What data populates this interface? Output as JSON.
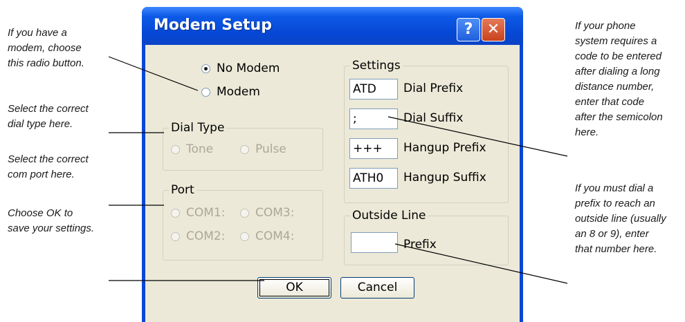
{
  "window": {
    "title": "Modem Setup",
    "help_glyph": "?",
    "close_glyph": "✕"
  },
  "modem": {
    "no_modem_label": "No Modem",
    "modem_label": "Modem",
    "selected": "No Modem"
  },
  "dial_type": {
    "legend": "Dial Type",
    "options": [
      "Tone",
      "Pulse"
    ]
  },
  "port": {
    "legend": "Port",
    "options": [
      "COM1:",
      "COM3:",
      "COM2:",
      "COM4:"
    ]
  },
  "settings": {
    "legend": "Settings",
    "fields": [
      {
        "value": "ATD",
        "label": "Dial Prefix"
      },
      {
        "value": ";",
        "label": "Dial Suffix"
      },
      {
        "value": "+++",
        "label": "Hangup Prefix"
      },
      {
        "value": "ATH0",
        "label": "Hangup Suffix"
      }
    ]
  },
  "outside_line": {
    "legend": "Outside Line",
    "value": "",
    "label": "Prefix"
  },
  "buttons": {
    "ok": "OK",
    "cancel": "Cancel"
  },
  "callouts": {
    "left": [
      [
        "If you have a",
        "modem, choose",
        "this radio button."
      ],
      [
        "Select the correct",
        "dial type here."
      ],
      [
        "Select the correct",
        "com port here."
      ],
      [
        "Choose OK to",
        "save your settings."
      ]
    ],
    "right": [
      [
        "If your phone",
        "system requires a",
        "code to be entered",
        "after dialing a long",
        "distance number,",
        "enter that code",
        "after the semicolon",
        "here."
      ],
      [
        "If you must dial a",
        "prefix to reach an",
        "outside line (usually",
        "an 8 or 9), enter",
        "that number here."
      ]
    ]
  }
}
